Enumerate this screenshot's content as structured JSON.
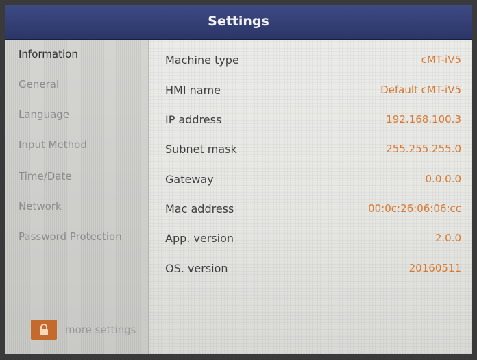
{
  "window": {
    "title": "Settings"
  },
  "sidebar": {
    "items": [
      {
        "label": "Information",
        "active": true
      },
      {
        "label": "General"
      },
      {
        "label": "Language"
      },
      {
        "label": "Input Method"
      },
      {
        "label": "Time/Date"
      },
      {
        "label": "Network"
      },
      {
        "label": "Password Protection"
      }
    ],
    "more": {
      "label": "more settings",
      "icon": "lock-icon"
    }
  },
  "info": {
    "rows": [
      {
        "label": "Machine type",
        "value": "cMT-iV5"
      },
      {
        "label": "HMI name",
        "value": "Default cMT-iV5"
      },
      {
        "label": "IP address",
        "value": "192.168.100.3"
      },
      {
        "label": "Subnet mask",
        "value": "255.255.255.0"
      },
      {
        "label": "Gateway",
        "value": "0.0.0.0"
      },
      {
        "label": "Mac address",
        "value": "00:0c:26:06:06:cc"
      },
      {
        "label": "App. version",
        "value": "2.0.0"
      },
      {
        "label": "OS. version",
        "value": "20160511"
      }
    ]
  },
  "colors": {
    "titlebar": "#2f3a73",
    "value_text": "#d9782f",
    "lock_button": "#c36a2c"
  }
}
